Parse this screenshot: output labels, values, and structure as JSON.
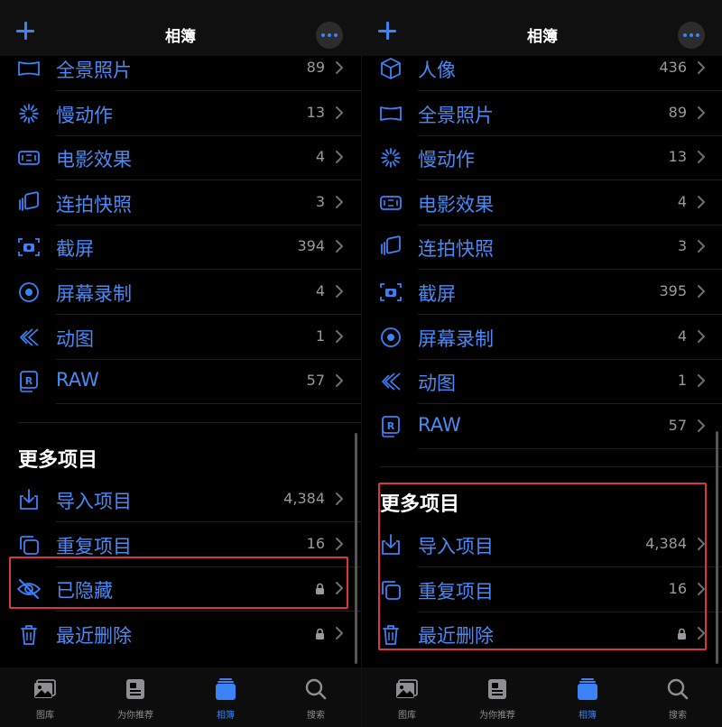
{
  "colors": {
    "accent": "#3b82f6",
    "label": "#4a8af4",
    "highlight": "#d9363e"
  },
  "left": {
    "nav": {
      "title": "相簿"
    },
    "rows": [
      {
        "id": "panorama",
        "icon": "panorama-icon",
        "label": "全景照片",
        "count": "89"
      },
      {
        "id": "slomo",
        "icon": "slow-motion-icon",
        "label": "慢动作",
        "count": "13"
      },
      {
        "id": "cinematic",
        "icon": "cinematic-icon",
        "label": "电影效果",
        "count": "4"
      },
      {
        "id": "burst",
        "icon": "burst-icon",
        "label": "连拍快照",
        "count": "3"
      },
      {
        "id": "screenshots",
        "icon": "screenshot-icon",
        "label": "截屏",
        "count": "394"
      },
      {
        "id": "screenrec",
        "icon": "screen-record-icon",
        "label": "屏幕录制",
        "count": "4"
      },
      {
        "id": "animated",
        "icon": "animated-icon",
        "label": "动图",
        "count": "1"
      },
      {
        "id": "raw",
        "icon": "raw-icon",
        "label": "RAW",
        "count": "57"
      }
    ],
    "more_title": "更多项目",
    "more_rows": [
      {
        "id": "imports",
        "icon": "import-icon",
        "label": "导入项目",
        "count": "4,384"
      },
      {
        "id": "duplicates",
        "icon": "duplicate-icon",
        "label": "重复项目",
        "count": "16"
      },
      {
        "id": "hidden",
        "icon": "hidden-eye-icon",
        "label": "已隐藏",
        "locked": true
      },
      {
        "id": "deleted",
        "icon": "trash-icon",
        "label": "最近删除",
        "locked": true
      }
    ]
  },
  "right": {
    "nav": {
      "title": "相簿"
    },
    "rows": [
      {
        "id": "portrait",
        "icon": "portrait-icon",
        "label": "人像",
        "count": "436"
      },
      {
        "id": "panorama",
        "icon": "panorama-icon",
        "label": "全景照片",
        "count": "89"
      },
      {
        "id": "slomo",
        "icon": "slow-motion-icon",
        "label": "慢动作",
        "count": "13"
      },
      {
        "id": "cinematic",
        "icon": "cinematic-icon",
        "label": "电影效果",
        "count": "4"
      },
      {
        "id": "burst",
        "icon": "burst-icon",
        "label": "连拍快照",
        "count": "3"
      },
      {
        "id": "screenshots",
        "icon": "screenshot-icon",
        "label": "截屏",
        "count": "395"
      },
      {
        "id": "screenrec",
        "icon": "screen-record-icon",
        "label": "屏幕录制",
        "count": "4"
      },
      {
        "id": "animated",
        "icon": "animated-icon",
        "label": "动图",
        "count": "1"
      },
      {
        "id": "raw",
        "icon": "raw-icon",
        "label": "RAW",
        "count": "57"
      }
    ],
    "more_title": "更多项目",
    "more_rows": [
      {
        "id": "imports",
        "icon": "import-icon",
        "label": "导入项目",
        "count": "4,384"
      },
      {
        "id": "duplicates",
        "icon": "duplicate-icon",
        "label": "重复项目",
        "count": "16"
      },
      {
        "id": "deleted",
        "icon": "trash-icon",
        "label": "最近删除",
        "locked": true
      }
    ]
  },
  "tabbar": [
    {
      "icon": "library-icon",
      "label": "图库"
    },
    {
      "icon": "for-you-icon",
      "label": "为你推荐"
    },
    {
      "icon": "albums-icon",
      "label": "相簿",
      "active": true
    },
    {
      "icon": "search-icon",
      "label": "搜索"
    }
  ]
}
